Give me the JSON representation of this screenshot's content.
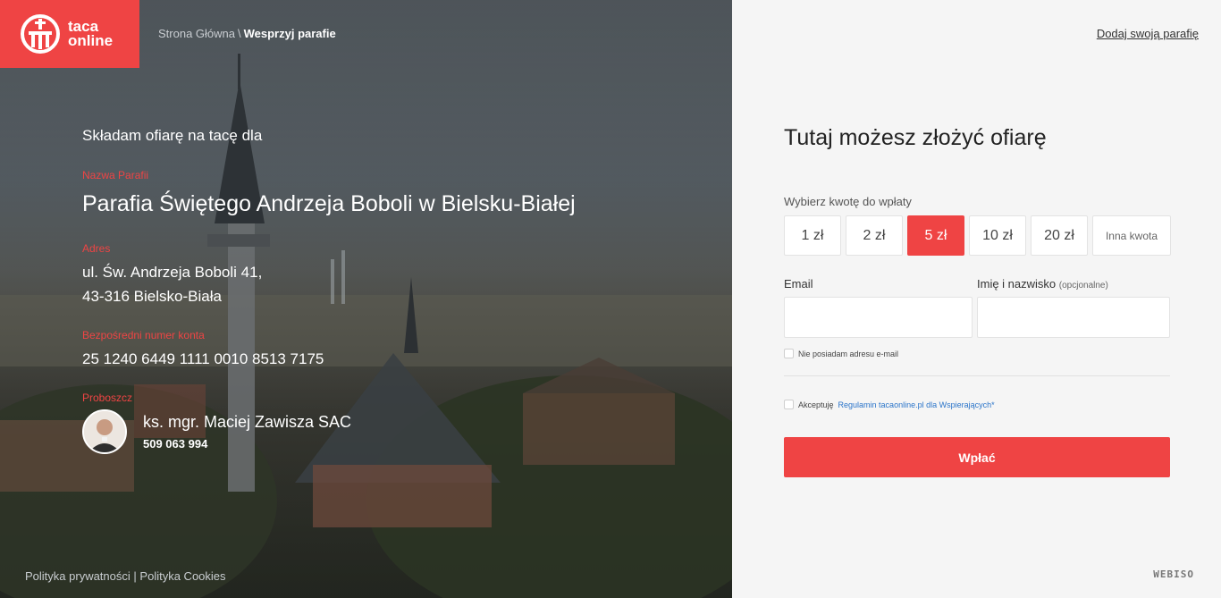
{
  "header": {
    "logo_line1": "taca",
    "logo_line2": "online",
    "breadcrumb": [
      {
        "label": "Strona Główna"
      },
      {
        "label": "Wesprzyj parafie"
      }
    ],
    "breadcrumb_sep": "\\",
    "add_parish_link": "Dodaj swoją parafię"
  },
  "parish_info": {
    "intro": "Składam ofiarę na tacę dla",
    "name_label": "Nazwa Parafii",
    "name": "Parafia Świętego Andrzeja Boboli w Bielsku-Białej",
    "address_label": "Adres",
    "address_line1": "ul. Św. Andrzeja Boboli 41,",
    "address_line2": "43-316 Bielsko-Biała",
    "account_label": "Bezpośredni numer konta",
    "account_number": "25 1240 6449 1111 0010 8513 7175",
    "priest_label": "Proboszcz",
    "priest_name": "ks. mgr. Maciej Zawisza SAC",
    "priest_phone": "509 063 994"
  },
  "footer": {
    "privacy": "Polityka prywatności",
    "sep": "|",
    "cookies": "Polityka Cookies",
    "brand": "WEBISO"
  },
  "form": {
    "title": "Tutaj możesz złożyć ofiarę",
    "amount_label": "Wybierz kwotę do wpłaty",
    "amounts": [
      "1 zł",
      "2 zł",
      "5 zł",
      "10 zł",
      "20 zł"
    ],
    "selected_amount": "5 zł",
    "other_amount": "Inna kwota",
    "email_label": "Email",
    "email_value": "",
    "name_label": "Imię i nazwisko",
    "name_optional": "(opcjonalne)",
    "name_value": "",
    "no_email_label": "Nie posiadam adresu e-mail",
    "accept_prefix": "Akceptuję",
    "accept_link": "Regulamin tacaonline.pl dla Wspierających",
    "accept_required": "*",
    "submit_label": "Wpłać"
  },
  "colors": {
    "accent": "#ef4444",
    "link": "#2a74c9"
  }
}
